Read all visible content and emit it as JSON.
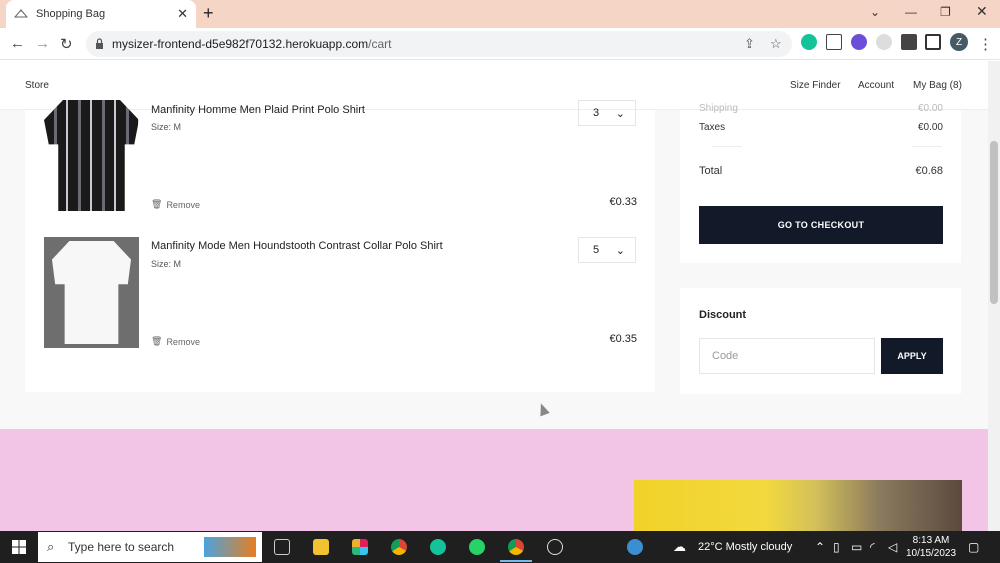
{
  "browser": {
    "tab_title": "Shopping Bag",
    "url_host": "mysizer-frontend-d5e982f70132.herokuapp.com",
    "url_path": "/cart",
    "profile_initial": "Z"
  },
  "site_nav": {
    "store": "Store",
    "size_finder": "Size Finder",
    "account": "Account",
    "my_bag": "My Bag (8)"
  },
  "cart": {
    "items": [
      {
        "name": "Manfinity Homme Men Plaid Print Polo Shirt",
        "size": "Size: M",
        "quantity": "3",
        "price": "€0.33",
        "remove_label": "Remove"
      },
      {
        "name": "Manfinity Mode Men Houndstooth Contrast Collar Polo Shirt",
        "size": "Size: M",
        "quantity": "5",
        "price": "€0.35",
        "remove_label": "Remove"
      }
    ]
  },
  "summary": {
    "shipping_label": "Shipping",
    "shipping_value": "€0.00",
    "taxes_label": "Taxes",
    "taxes_value": "€0.00",
    "total_label": "Total",
    "total_value": "€0.68",
    "checkout_label": "GO TO CHECKOUT"
  },
  "discount": {
    "title": "Discount",
    "placeholder": "Code",
    "apply_label": "APPLY"
  },
  "taskbar": {
    "search_placeholder": "Type here to search",
    "weather": "22°C  Mostly cloudy",
    "time": "8:13 AM",
    "date": "10/15/2023"
  },
  "colors": {
    "accent_dark": "#121a2a",
    "pink_band": "#f2c4e5",
    "tab_bar": "#f5d6c6"
  }
}
